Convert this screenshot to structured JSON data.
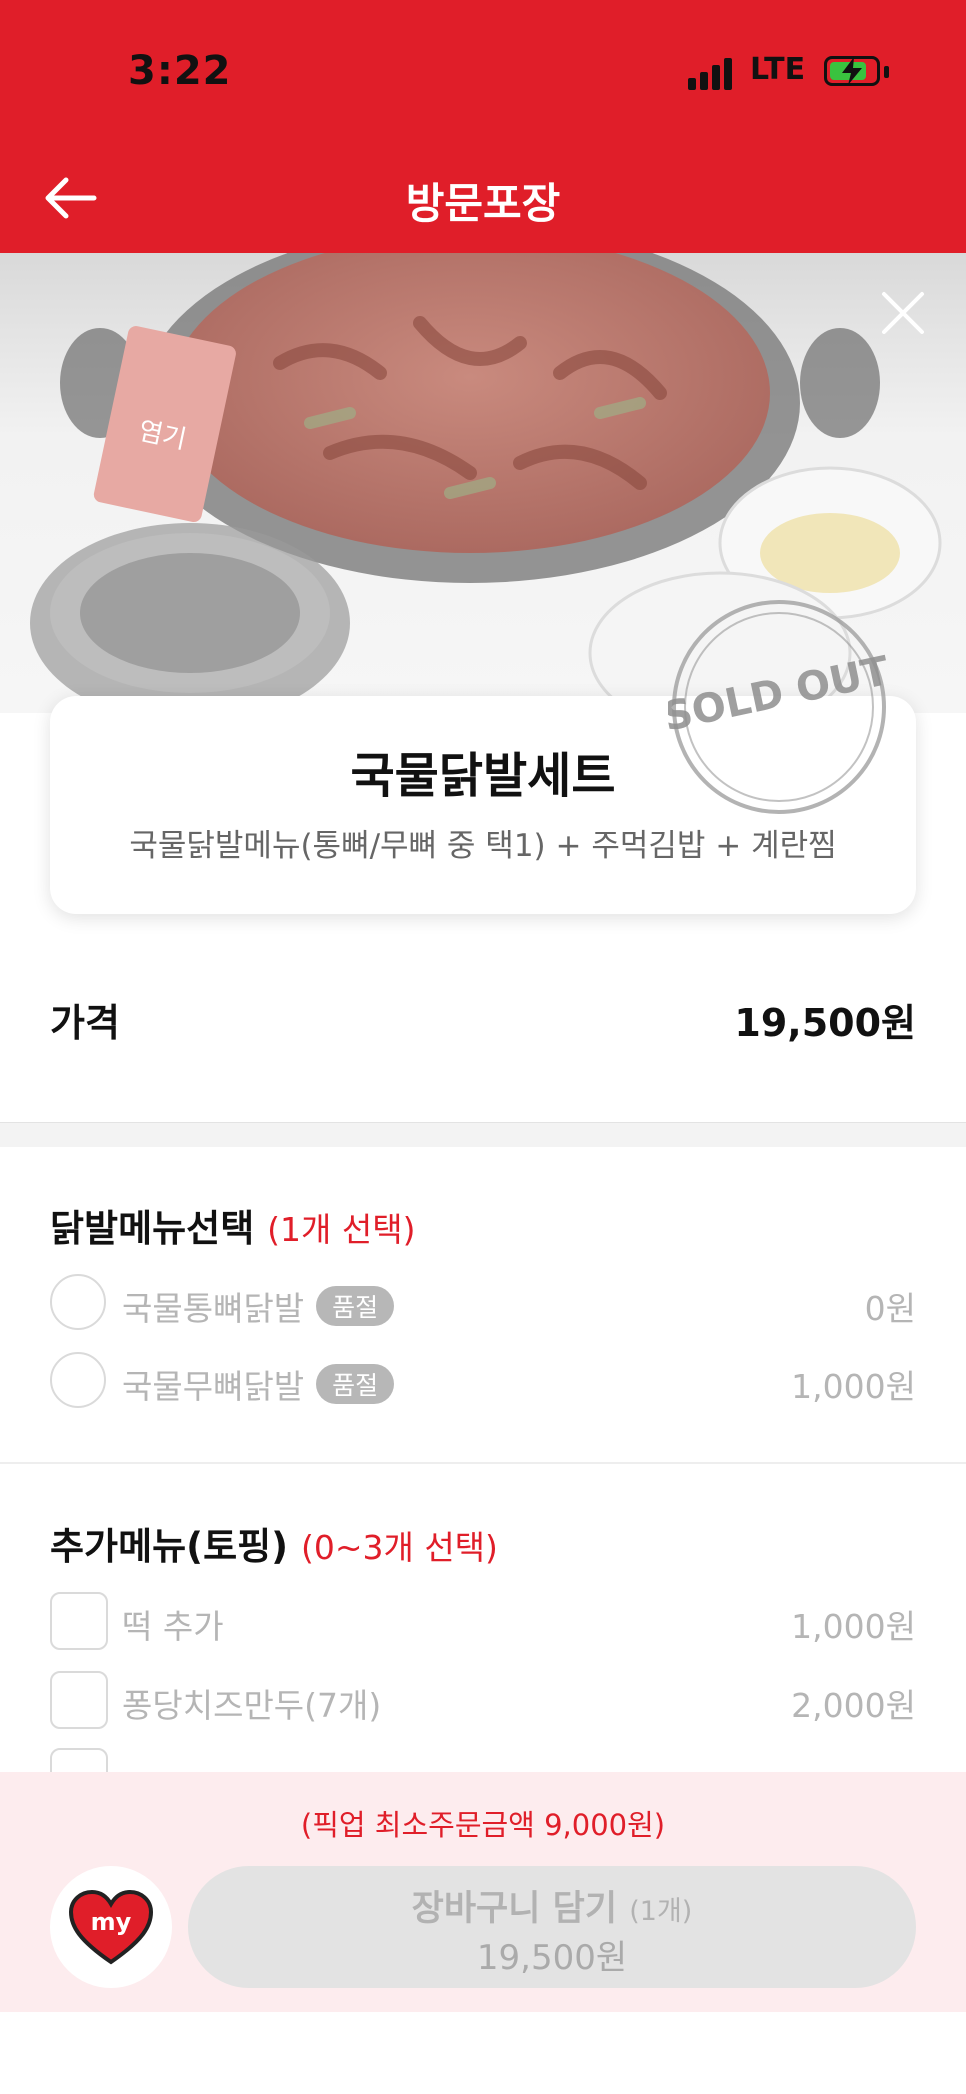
{
  "status_bar": {
    "time": "3:22",
    "network": "LTE"
  },
  "header": {
    "title": "방문포장"
  },
  "product": {
    "name": "국물닭발세트",
    "description": "국물닭발메뉴(통뼈/무뼈 중 택1) + 주먹김밥 + 계란찜",
    "sold_out_text": "SOLD OUT",
    "sauce_label": "염기"
  },
  "price": {
    "label": "가격",
    "value": "19,500원"
  },
  "section1": {
    "title": "닭발메뉴선택",
    "requirement": "(1개 선택)",
    "options": [
      {
        "label": "국물통뼈닭발",
        "badge": "품절",
        "price": "0원"
      },
      {
        "label": "국물무뼈닭발",
        "badge": "품절",
        "price": "1,000원"
      }
    ]
  },
  "section2": {
    "title": "추가메뉴(토핑)",
    "requirement": "(0~3개 선택)",
    "options": [
      {
        "label": "떡 추가",
        "price": "1,000원"
      },
      {
        "label": "퐁당치즈만두(7개)",
        "price": "2,000원"
      }
    ]
  },
  "footer": {
    "min_order": "(픽업 최소주문금액 9,000원)",
    "my_label": "my",
    "cart_label": "장바구니 담기",
    "cart_count": "(1개)",
    "cart_price": "19,500원"
  },
  "colors": {
    "brand_red": "#e01e29",
    "disabled_gray": "#b5b5b5"
  }
}
